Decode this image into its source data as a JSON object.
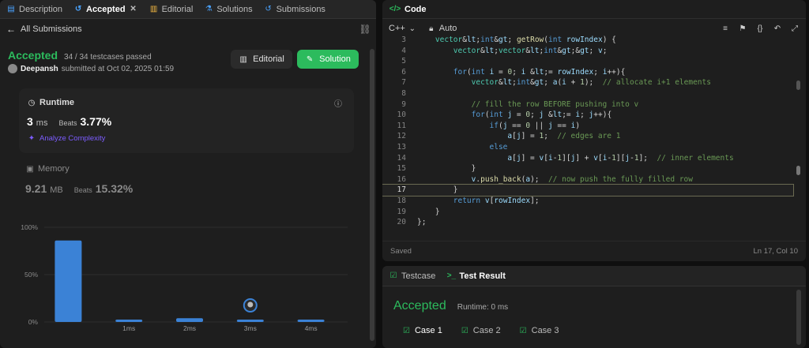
{
  "tabs": [
    {
      "icon": "description-icon",
      "label": "Description"
    },
    {
      "icon": "history-icon",
      "label": "Accepted",
      "active": true
    },
    {
      "icon": "book-icon",
      "label": "Editorial"
    },
    {
      "icon": "flask-icon",
      "label": "Solutions"
    },
    {
      "icon": "history-icon",
      "label": "Submissions"
    }
  ],
  "back_label": "All Submissions",
  "result": {
    "status": "Accepted",
    "passed": "34 / 34 testcases passed",
    "user": "Deepansh",
    "submitted": "submitted at Oct 02, 2025 01:59"
  },
  "buttons": {
    "editorial": "Editorial",
    "solution": "Solution"
  },
  "runtime": {
    "title": "Runtime",
    "value": "3",
    "unit": "ms",
    "beats_label": "Beats",
    "beats": "3.77%",
    "analyze": "Analyze Complexity"
  },
  "memory": {
    "title": "Memory",
    "value": "9.21",
    "unit": "MB",
    "beats_label": "Beats",
    "beats": "15.32%"
  },
  "chart_data": {
    "type": "bar",
    "categories": [
      "",
      "1ms",
      "2ms",
      "3ms",
      "4ms"
    ],
    "values": [
      86,
      2,
      4,
      2,
      2
    ],
    "highlight_index": 3,
    "y_ticks": [
      "100%",
      "50%",
      "0%"
    ],
    "ylim": [
      0,
      100
    ]
  },
  "code_panel": {
    "title": "Code",
    "language": "C++",
    "mode": "Auto",
    "status": "Saved",
    "cursor": "Ln 17, Col 10",
    "current_line": 17
  },
  "code_lines": [
    {
      "n": "3",
      "t": "    vector<int> getRow(int rowIndex) {"
    },
    {
      "n": "4",
      "t": "        vector<vector<int>> v;"
    },
    {
      "n": "5",
      "t": ""
    },
    {
      "n": "6",
      "t": "        for(int i = 0; i <= rowIndex; i++){"
    },
    {
      "n": "7",
      "t": "            vector<int> a(i + 1);  // allocate i+1 elements"
    },
    {
      "n": "8",
      "t": ""
    },
    {
      "n": "9",
      "t": "            // fill the row BEFORE pushing into v"
    },
    {
      "n": "10",
      "t": "            for(int j = 0; j <= i; j++){"
    },
    {
      "n": "11",
      "t": "                if(j == 0 || j == i)"
    },
    {
      "n": "12",
      "t": "                    a[j] = 1;  // edges are 1"
    },
    {
      "n": "13",
      "t": "                else"
    },
    {
      "n": "14",
      "t": "                    a[j] = v[i-1][j] + v[i-1][j-1];  // inner elements"
    },
    {
      "n": "15",
      "t": "            }"
    },
    {
      "n": "16",
      "t": "            v.push_back(a);  // now push the fully filled row"
    },
    {
      "n": "17",
      "t": "        }"
    },
    {
      "n": "18",
      "t": "        return v[rowIndex];"
    },
    {
      "n": "19",
      "t": "    }"
    },
    {
      "n": "20",
      "t": "};"
    }
  ],
  "test_panel": {
    "tabs": [
      {
        "icon": "checkbox-icon",
        "label": "Testcase"
      },
      {
        "icon": "terminal-icon",
        "label": "Test Result",
        "active": true
      }
    ],
    "status": "Accepted",
    "runtime": "Runtime: 0 ms",
    "cases": [
      "Case 1",
      "Case 2",
      "Case 3"
    ]
  },
  "colors": {
    "accent_green": "#2cbb5d",
    "bar_blue": "#3b82d6",
    "purple_link": "#7c5cff"
  }
}
